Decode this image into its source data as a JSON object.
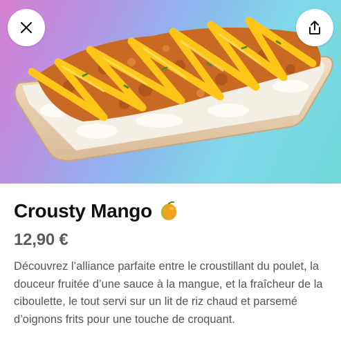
{
  "header": {
    "close_icon": "close-icon",
    "share_icon": "share-icon"
  },
  "item": {
    "image_name": "food-photo",
    "title": "Crousty Mango",
    "emoji_icon": "mango-icon",
    "price": "12,90 €",
    "description": "Découvrez l’alliance parfaite entre le croustillant du poulet, la douceur fruitée d’une sauce à la mangue, et la fraîcheur de la ciboulette, le tout servi sur un lit de riz chaud et parsemé d’oignons frits pour une touche de croquant."
  },
  "colors": {
    "background_pink": "#d77fd2",
    "background_cyan": "#6fd7d9",
    "sauce": "#ffc61a",
    "tray": "#e9d2b4"
  }
}
